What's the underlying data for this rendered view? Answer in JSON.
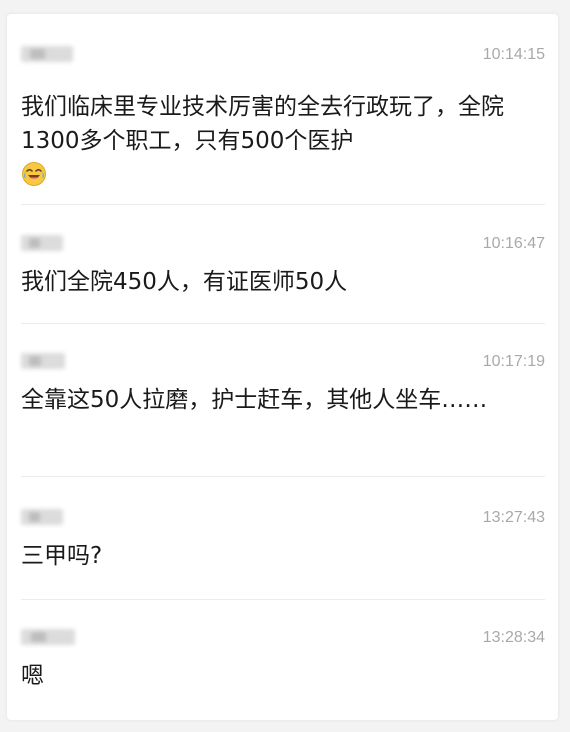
{
  "messages": [
    {
      "time": "10:14:15",
      "text": "我们临床里专业技术厉害的全去行政玩了，全院1300多个职工，只有500个医护",
      "emoji": "laughing-crying-face-icon"
    },
    {
      "time": "10:16:47",
      "text": "我们全院450人，有证医师50人"
    },
    {
      "time": "10:17:19",
      "text": "全靠这50人拉磨，护士赶车，其他人坐车……"
    },
    {
      "time": "13:27:43",
      "text": "三甲吗?"
    },
    {
      "time": "13:28:34",
      "text": "嗯"
    }
  ]
}
